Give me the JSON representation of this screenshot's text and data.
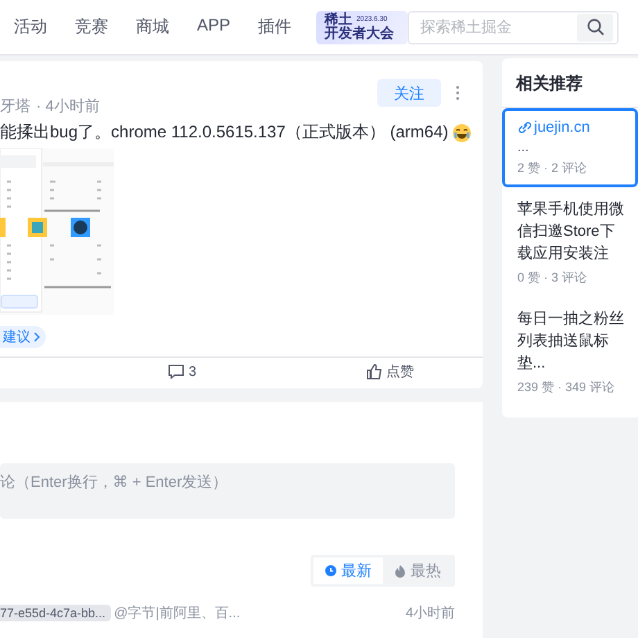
{
  "nav": {
    "items": [
      {
        "label": "活动"
      },
      {
        "label": "竞赛"
      },
      {
        "label": "商城"
      },
      {
        "label": "APP"
      },
      {
        "label": "插件"
      }
    ],
    "banner": {
      "title": "稀土",
      "subtitle": "开发者大会",
      "date": "2023.6.30"
    },
    "search": {
      "placeholder": "探索稀土掘金"
    }
  },
  "post": {
    "author": "牙塔",
    "time": "· 4小时前",
    "follow_button": "关注",
    "content": "能揉出bug了。chrome 112.0.5615.137（正式版本） (arm64)",
    "tag": "建议",
    "comment_count": "3",
    "like_label": "点赞"
  },
  "comments": {
    "input": {
      "placeholder": "论（Enter换行，⌘ + Enter发送）"
    },
    "sort_tabs": [
      {
        "kind": "newest",
        "label": "最新",
        "selected": true
      },
      {
        "kind": "hot",
        "label": "最热",
        "selected": false
      }
    ],
    "items": [
      {
        "user": "77-e55d-4c7a-bb...",
        "title": "@字节|前阿里、百...",
        "time": "4小时前"
      }
    ]
  },
  "related": {
    "title": "相关推荐",
    "items": [
      {
        "kind": "link",
        "title": "juejin.cn",
        "excerpt": "...",
        "stats": "2 赞 · 2 评论",
        "selected": true
      },
      {
        "kind": "article",
        "title": "苹果手机使用微信扫邀Store下载应用安装注",
        "stats": "0 赞 · 3 评论",
        "selected": false
      },
      {
        "kind": "article",
        "title": "每日一抽之粉丝列表抽送鼠标垫...",
        "stats": "239 赞 · 349 评论",
        "selected": false
      }
    ]
  }
}
